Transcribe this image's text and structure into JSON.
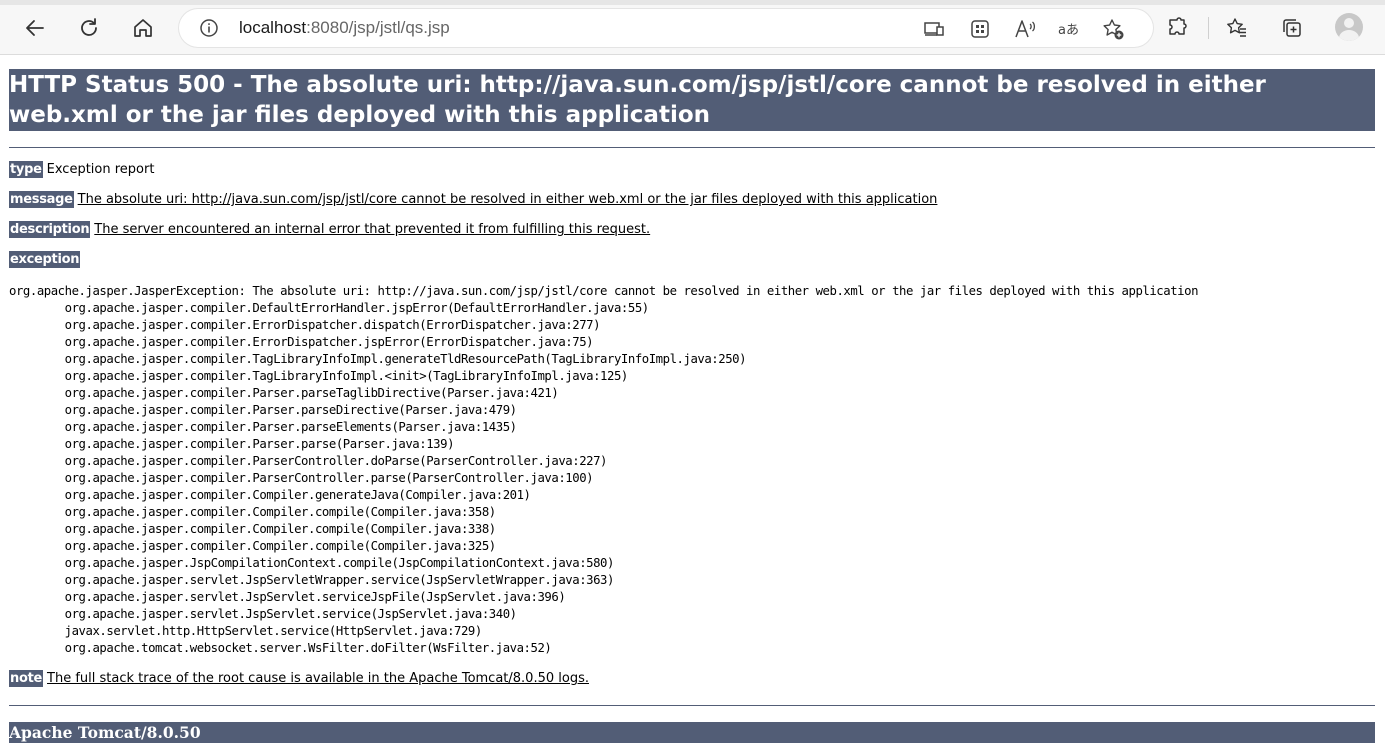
{
  "browser": {
    "url_host": "localhost",
    "url_rest": ":8080/jsp/jstl/qs.jsp"
  },
  "page": {
    "title": "HTTP Status 500 - The absolute uri: http://java.sun.com/jsp/jstl/core cannot be resolved in either web.xml or the jar files deployed with this application",
    "type_label": "type",
    "type_value": "Exception report",
    "message_label": "message",
    "message_value": "The absolute uri: http://java.sun.com/jsp/jstl/core cannot be resolved in either web.xml or the jar files deployed with this application",
    "description_label": "description",
    "description_value": "The server encountered an internal error that prevented it from fulfilling this request.",
    "exception_label": "exception",
    "exception_head": "org.apache.jasper.JasperException: The absolute uri: http://java.sun.com/jsp/jstl/core cannot be resolved in either web.xml or the jar files deployed with this application",
    "stack": [
      "org.apache.jasper.compiler.DefaultErrorHandler.jspError(DefaultErrorHandler.java:55)",
      "org.apache.jasper.compiler.ErrorDispatcher.dispatch(ErrorDispatcher.java:277)",
      "org.apache.jasper.compiler.ErrorDispatcher.jspError(ErrorDispatcher.java:75)",
      "org.apache.jasper.compiler.TagLibraryInfoImpl.generateTldResourcePath(TagLibraryInfoImpl.java:250)",
      "org.apache.jasper.compiler.TagLibraryInfoImpl.<init>(TagLibraryInfoImpl.java:125)",
      "org.apache.jasper.compiler.Parser.parseTaglibDirective(Parser.java:421)",
      "org.apache.jasper.compiler.Parser.parseDirective(Parser.java:479)",
      "org.apache.jasper.compiler.Parser.parseElements(Parser.java:1435)",
      "org.apache.jasper.compiler.Parser.parse(Parser.java:139)",
      "org.apache.jasper.compiler.ParserController.doParse(ParserController.java:227)",
      "org.apache.jasper.compiler.ParserController.parse(ParserController.java:100)",
      "org.apache.jasper.compiler.Compiler.generateJava(Compiler.java:201)",
      "org.apache.jasper.compiler.Compiler.compile(Compiler.java:358)",
      "org.apache.jasper.compiler.Compiler.compile(Compiler.java:338)",
      "org.apache.jasper.compiler.Compiler.compile(Compiler.java:325)",
      "org.apache.jasper.JspCompilationContext.compile(JspCompilationContext.java:580)",
      "org.apache.jasper.servlet.JspServletWrapper.service(JspServletWrapper.java:363)",
      "org.apache.jasper.servlet.JspServlet.serviceJspFile(JspServlet.java:396)",
      "org.apache.jasper.servlet.JspServlet.service(JspServlet.java:340)",
      "javax.servlet.http.HttpServlet.service(HttpServlet.java:729)",
      "org.apache.tomcat.websocket.server.WsFilter.doFilter(WsFilter.java:52)"
    ],
    "note_label": "note",
    "note_value": "The full stack trace of the root cause is available in the Apache Tomcat/8.0.50 logs.",
    "footer": "Apache Tomcat/8.0.50"
  },
  "colors": {
    "header_bg": "#525d76",
    "header_text": "#ffffff"
  }
}
